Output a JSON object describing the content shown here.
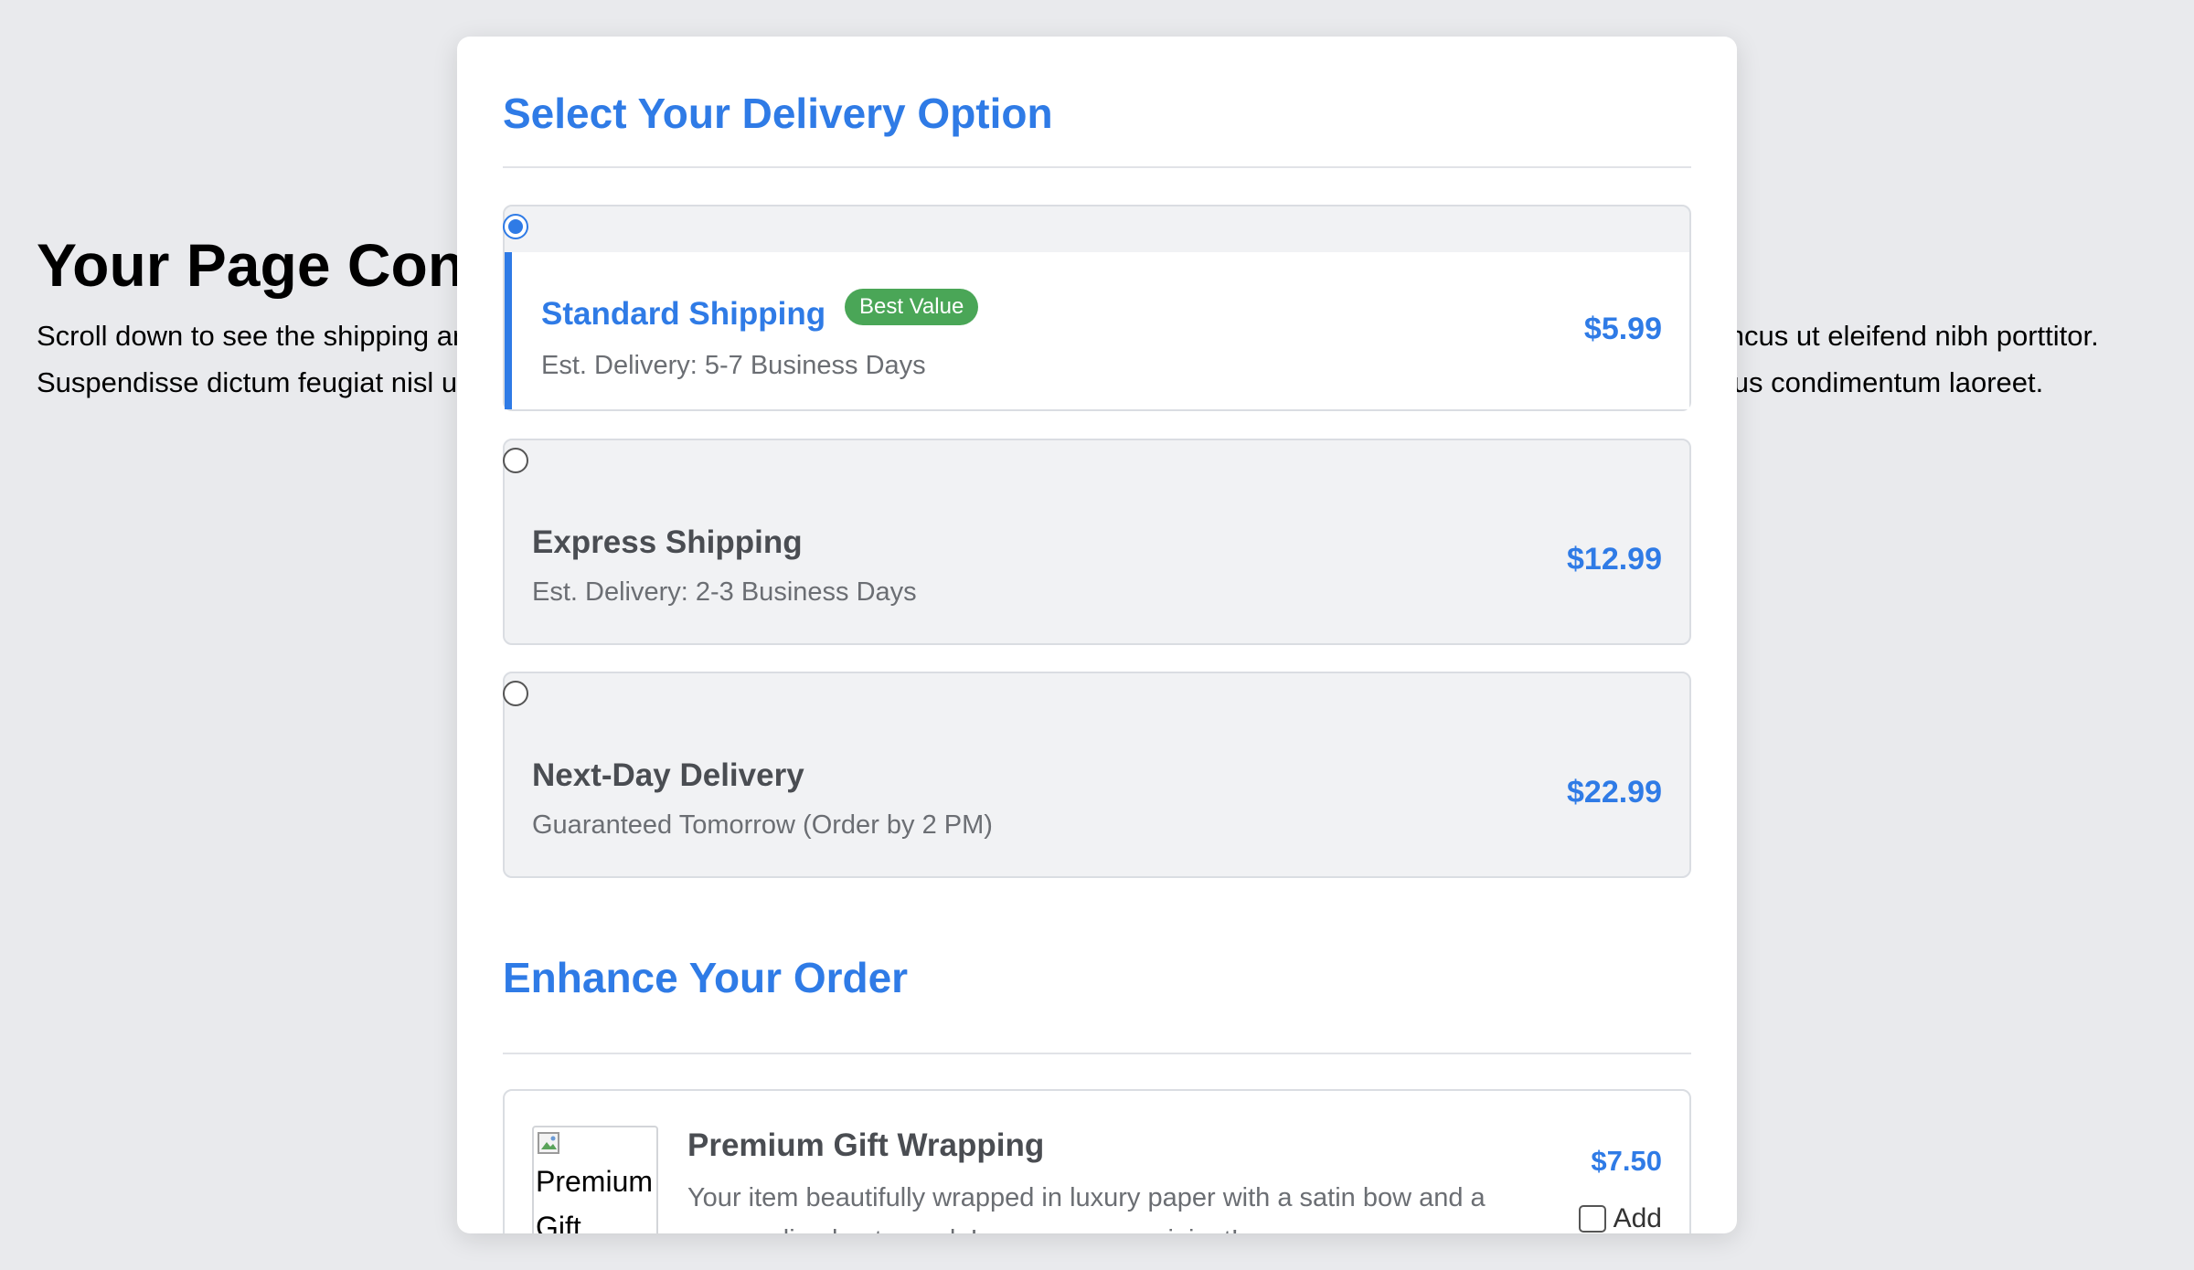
{
  "background": {
    "heading": "Your Page Content",
    "paragraph": "Scroll down to see the shipping and gift options. Lorem ipsum dolor sit amet, consectetur adipiscing elit. Sed auctor neque eu tellus rhoncus ut eleifend nibh porttitor. Suspendisse dictum feugiat nisl ut dapibus. Mauris iaculis porttitor posuere. Dignissim congue. Donec congue lacinia dui, a porttitor lectus condimentum laoreet."
  },
  "delivery": {
    "title": "Select Your Delivery Option",
    "options": [
      {
        "name": "Standard Shipping",
        "badge": "Best Value",
        "description": "Est. Delivery: 5-7 Business Days",
        "price": "$5.99",
        "selected": true
      },
      {
        "name": "Express Shipping",
        "description": "Est. Delivery: 2-3 Business Days",
        "price": "$12.99",
        "selected": false
      },
      {
        "name": "Next-Day Delivery",
        "description": "Guaranteed Tomorrow (Order by 2 PM)",
        "price": "$22.99",
        "selected": false
      }
    ]
  },
  "enhance": {
    "title": "Enhance Your Order",
    "addons": [
      {
        "image_alt": "Premium Gift",
        "name": "Premium Gift Wrapping",
        "description": "Your item beautifully wrapped in luxury paper with a satin bow and a personalized note card. Impress your recipient!",
        "price": "$7.50",
        "checkbox_label": "Add",
        "checked": false
      }
    ]
  },
  "colors": {
    "accent": "#2f7be6",
    "badge": "#4aa657",
    "page_background": "#e9eaed"
  },
  "icons": {
    "broken_image": "broken-image-icon"
  }
}
